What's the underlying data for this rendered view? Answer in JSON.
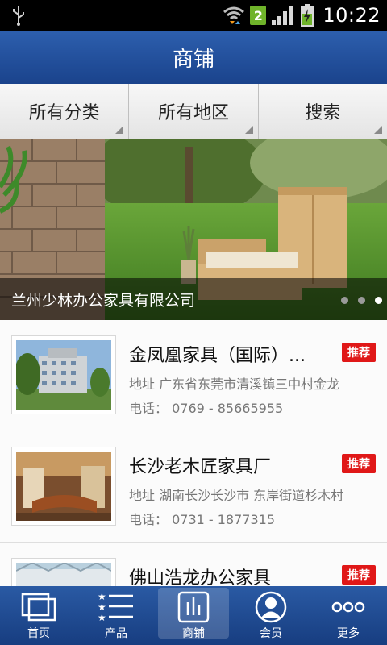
{
  "status_bar": {
    "time": "10:22",
    "sim_number": "2",
    "icons": [
      "usb-icon",
      "wifi-icon",
      "signal-icon",
      "battery-charging-icon"
    ]
  },
  "header": {
    "title": "商铺"
  },
  "filters": [
    {
      "label": "所有分类"
    },
    {
      "label": "所有地区"
    },
    {
      "label": "搜索"
    }
  ],
  "banner": {
    "title": "兰州少林办公家具有限公司",
    "dots": 3,
    "active_dot": 3
  },
  "stores": [
    {
      "name": "金凤凰家具（国际）...",
      "badge": "推荐",
      "address": "地址  广东省东莞市清溪镇三中村金龙",
      "phone": "电话：  0769 - 85665955"
    },
    {
      "name": "长沙老木匠家具厂",
      "badge": "推荐",
      "address": "地址  湖南长沙长沙市 东岸街道杉木村",
      "phone": "电话：  0731 - 1877315"
    },
    {
      "name": "佛山浩龙办公家具",
      "badge": "推荐",
      "address": "",
      "phone": ""
    }
  ],
  "bottom_nav": [
    {
      "label": "首页",
      "icon": "home-icon"
    },
    {
      "label": "产品",
      "icon": "list-icon"
    },
    {
      "label": "商铺",
      "icon": "chart-icon",
      "active": true
    },
    {
      "label": "会员",
      "icon": "user-icon"
    },
    {
      "label": "更多",
      "icon": "more-icon"
    }
  ],
  "colors": {
    "header_blue": "#1a438c",
    "badge_red": "#e01818",
    "sim_green": "#6fb32a"
  }
}
